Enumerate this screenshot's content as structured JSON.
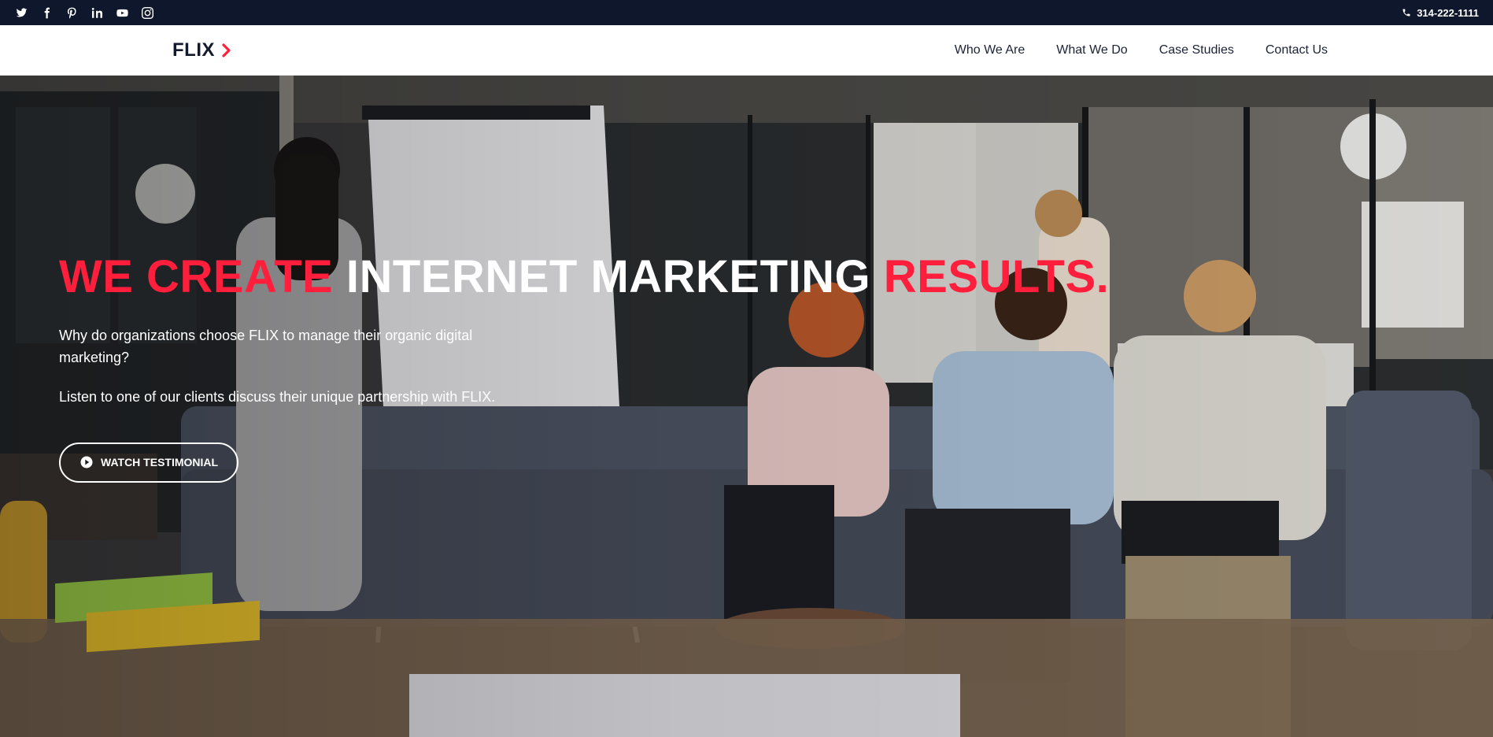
{
  "topbar": {
    "social_icons": [
      "twitter-icon",
      "facebook-icon",
      "pinterest-icon",
      "linkedin-icon",
      "youtube-icon",
      "instagram-icon"
    ],
    "phone": "314-222-1111"
  },
  "nav": {
    "logo": "FLIX",
    "menu": [
      "Who We Are",
      "What We Do",
      "Case Studies",
      "Contact Us"
    ]
  },
  "hero": {
    "headline": {
      "part1": "WE CREATE",
      "part2": "INTERNET MARKETING",
      "part3": "RESULTS."
    },
    "paragraph1": "Why do organizations choose FLIX to manage their organic digital marketing?",
    "paragraph2": "Listen to one of our clients discuss their unique partnership with FLIX.",
    "cta_label": "WATCH TESTIMONIAL"
  },
  "colors": {
    "accent": "#ff1f3d",
    "topbar": "#0f172c",
    "nav_text": "#1c2238"
  }
}
